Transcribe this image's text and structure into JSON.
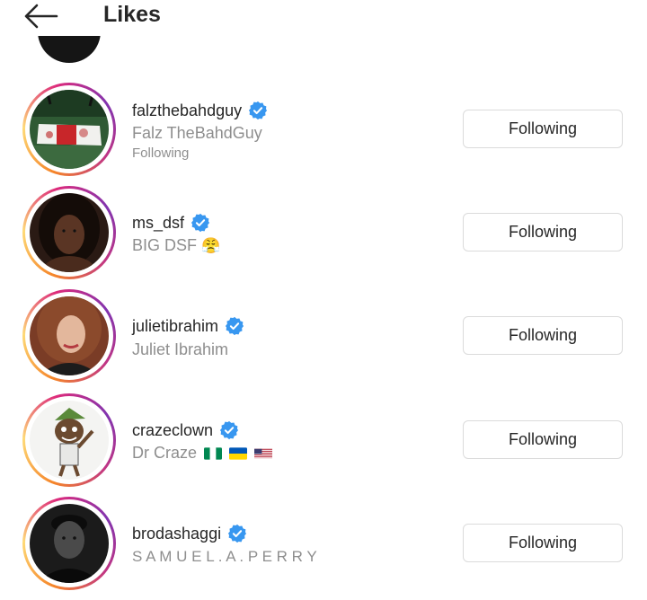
{
  "header": {
    "title": "Likes",
    "back_icon": "arrow-left-icon"
  },
  "accent": {
    "verified": "#3897f0"
  },
  "users": [
    {
      "username": "falzthebahdguy",
      "fullname": "Falz TheBahdGuy",
      "sub": "Following",
      "button": "Following"
    },
    {
      "username": "ms_dsf",
      "fullname": "BIG DSF",
      "emoji": "😤",
      "button": "Following"
    },
    {
      "username": "julietibrahim",
      "fullname": "Juliet Ibrahim",
      "button": "Following"
    },
    {
      "username": "crazeclown",
      "fullname": "Dr Craze",
      "flags": [
        "nigeria-flag",
        "ukraine-flag",
        "usa-flag"
      ],
      "button": "Following"
    },
    {
      "username": "brodashaggi",
      "fullname": "S A M U E L . A . P E R R Y",
      "button": "Following"
    }
  ]
}
